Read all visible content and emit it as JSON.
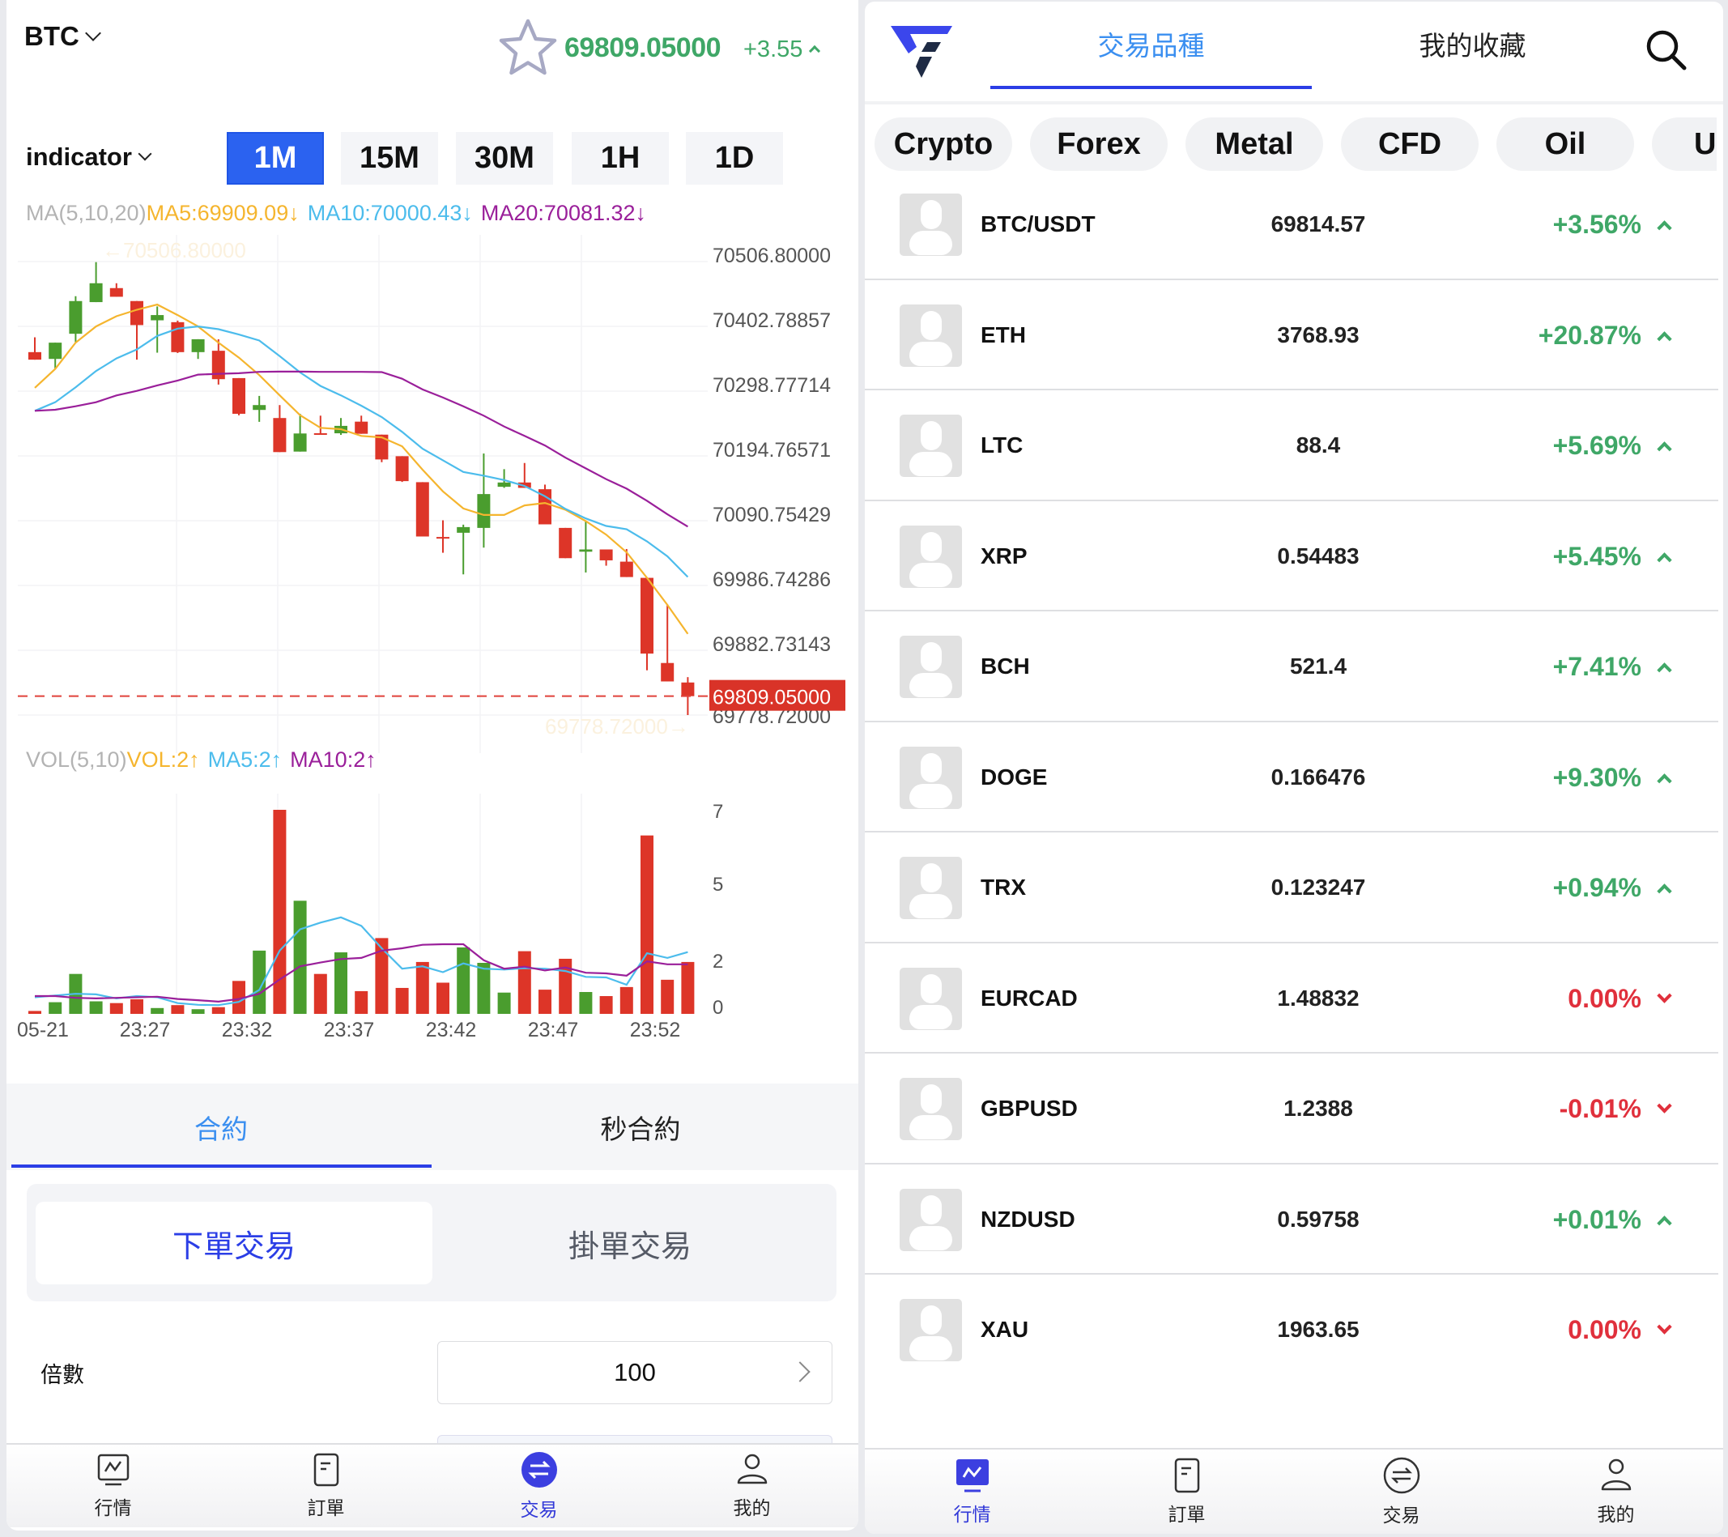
{
  "left": {
    "symbol": "BTC",
    "price": "69809.05000",
    "change": "+3.55",
    "indicator_label": "indicator",
    "timeframes": [
      {
        "label": "1M",
        "active": true
      },
      {
        "label": "15M",
        "active": false
      },
      {
        "label": "30M",
        "active": false
      },
      {
        "label": "1H",
        "active": false
      },
      {
        "label": "1D",
        "active": false
      }
    ],
    "ma_legend": {
      "name": "MA(5,10,20)",
      "ma5": "MA5:69909.09↓",
      "ma10": "MA10:70000.43↓",
      "ma20": "MA20:70081.32↓"
    },
    "vol_legend": {
      "name": "VOL(5,10)",
      "vol": "VOL:2↑",
      "ma5": "MA5:2↑",
      "ma10": "MA10:2↑"
    },
    "contract_tabs": [
      {
        "label": "合約",
        "active": true
      },
      {
        "label": "秒合約",
        "active": false
      }
    ],
    "order_types": [
      {
        "label": "下單交易",
        "active": true
      },
      {
        "label": "掛單交易",
        "active": false
      }
    ],
    "leverage_label": "倍數",
    "leverage_value": "100",
    "bottom_nav": [
      {
        "label": "行情",
        "icon": "market-chart-icon",
        "active": false
      },
      {
        "label": "訂單",
        "icon": "order-doc-icon",
        "active": false
      },
      {
        "label": "交易",
        "icon": "trade-exchange-icon",
        "active": true
      },
      {
        "label": "我的",
        "icon": "user-profile-icon",
        "active": false
      }
    ]
  },
  "right": {
    "tabs": [
      {
        "label": "交易品種",
        "active": true
      },
      {
        "label": "我的收藏",
        "active": false
      }
    ],
    "categories": [
      "Crypto",
      "Forex",
      "Metal",
      "CFD",
      "Oil",
      "U"
    ],
    "markets": [
      {
        "name": "BTC/USDT",
        "price": "69814.57",
        "change": "+3.56%",
        "direction": "up"
      },
      {
        "name": "ETH",
        "price": "3768.93",
        "change": "+20.87%",
        "direction": "up"
      },
      {
        "name": "LTC",
        "price": "88.4",
        "change": "+5.69%",
        "direction": "up"
      },
      {
        "name": "XRP",
        "price": "0.54483",
        "change": "+5.45%",
        "direction": "up"
      },
      {
        "name": "BCH",
        "price": "521.4",
        "change": "+7.41%",
        "direction": "up"
      },
      {
        "name": "DOGE",
        "price": "0.166476",
        "change": "+9.30%",
        "direction": "up"
      },
      {
        "name": "TRX",
        "price": "0.123247",
        "change": "+0.94%",
        "direction": "up"
      },
      {
        "name": "EURCAD",
        "price": "1.48832",
        "change": "0.00%",
        "direction": "down"
      },
      {
        "name": "GBPUSD",
        "price": "1.2388",
        "change": "-0.01%",
        "direction": "down"
      },
      {
        "name": "NZDUSD",
        "price": "0.59758",
        "change": "+0.01%",
        "direction": "up"
      },
      {
        "name": "XAU",
        "price": "1963.65",
        "change": "0.00%",
        "direction": "down"
      }
    ],
    "bottom_nav": [
      {
        "label": "行情",
        "icon": "market-chart-icon",
        "active": true
      },
      {
        "label": "訂單",
        "icon": "order-doc-icon",
        "active": false
      },
      {
        "label": "交易",
        "icon": "trade-exchange-icon",
        "active": false
      },
      {
        "label": "我的",
        "icon": "user-profile-icon",
        "active": false
      }
    ]
  },
  "colors": {
    "up": "#3fa767",
    "down": "#e0303c",
    "candle_up": "#4a9d2e",
    "candle_down": "#dd3528",
    "ma5": "#f5b52e",
    "ma10": "#4cbcec",
    "ma20": "#9a1f9a",
    "accent": "#2b3ee6",
    "tab_active_text": "#3b8ff0"
  },
  "chart_data": [
    {
      "type": "candlestick",
      "title": "BTC 1M",
      "price_axis_ticks": [
        "70506.80000",
        "70402.78857",
        "70298.77714",
        "70194.76571",
        "70090.75429",
        "69986.74286",
        "69882.73143",
        "69778.72000"
      ],
      "ylim": [
        69778.72,
        70506.8
      ],
      "max_marker": "←70506.80000",
      "min_marker": "69778.72000→",
      "last_price": 69809.05,
      "last_price_label": "69809.05000",
      "candles": [
        {
          "o": 70361.4,
          "h": 70385.2,
          "l": 70349.3,
          "c": 70349.3
        },
        {
          "o": 70350.5,
          "h": 70376.6,
          "l": 70335.3,
          "c": 70376.6
        },
        {
          "o": 70390.9,
          "h": 70451.2,
          "l": 70376.6,
          "c": 70443.4
        },
        {
          "o": 70441.7,
          "h": 70505.9,
          "l": 70441.7,
          "c": 70472.0
        },
        {
          "o": 70464.2,
          "h": 70472.0,
          "l": 70450.3,
          "c": 70450.3
        },
        {
          "o": 70443.4,
          "h": 70443.4,
          "l": 70349.3,
          "c": 70404.8
        },
        {
          "o": 70412.5,
          "h": 70434.7,
          "l": 70360.5,
          "c": 70420.9
        },
        {
          "o": 70409.5,
          "h": 70412.0,
          "l": 70360.0,
          "c": 70361.4
        },
        {
          "o": 70361.4,
          "h": 70382.1,
          "l": 70350.5,
          "c": 70382.1
        },
        {
          "o": 70363.6,
          "h": 70382.1,
          "l": 70309.3,
          "c": 70318.0
        },
        {
          "o": 70319.7,
          "h": 70319.7,
          "l": 70260.0,
          "c": 70262.4
        },
        {
          "o": 70268.6,
          "h": 70291.1,
          "l": 70249.5,
          "c": 70276.4
        },
        {
          "o": 70255.6,
          "h": 70276.4,
          "l": 70200.9,
          "c": 70200.9
        },
        {
          "o": 70201.7,
          "h": 70262.4,
          "l": 70201.7,
          "c": 70230.8
        },
        {
          "o": 70231.2,
          "h": 70259.4,
          "l": 70230.8,
          "c": 70230.8
        },
        {
          "o": 70231.1,
          "h": 70255.6,
          "l": 70228.5,
          "c": 70243.0
        },
        {
          "o": 70249.8,
          "h": 70259.4,
          "l": 70230.3,
          "c": 70230.3
        },
        {
          "o": 70228.9,
          "h": 70228.9,
          "l": 70184.7,
          "c": 70189.1
        },
        {
          "o": 70194.3,
          "h": 70194.3,
          "l": 70153.0,
          "c": 70154.3
        },
        {
          "o": 70152.6,
          "h": 70152.6,
          "l": 70065.4,
          "c": 70065.4
        },
        {
          "o": 70064.6,
          "h": 70091.4,
          "l": 70039.3,
          "c": 70064.1
        },
        {
          "o": 70071.4,
          "h": 70084.4,
          "l": 70004.6,
          "c": 70080.5
        },
        {
          "o": 70079.2,
          "h": 70198.6,
          "l": 70047.6,
          "c": 70133.5
        },
        {
          "o": 70145.2,
          "h": 70173.5,
          "l": 70143.5,
          "c": 70152.1
        },
        {
          "o": 70152.1,
          "h": 70183.4,
          "l": 70143.5,
          "c": 70143.5
        },
        {
          "o": 70141.3,
          "h": 70148.7,
          "l": 70084.9,
          "c": 70084.9
        },
        {
          "o": 70079.2,
          "h": 70079.2,
          "l": 70030.6,
          "c": 70030.6
        },
        {
          "o": 70041.0,
          "h": 70090.1,
          "l": 70007.6,
          "c": 70044.6
        },
        {
          "o": 70044.6,
          "h": 70044.6,
          "l": 70018.5,
          "c": 70027.1
        },
        {
          "o": 70025.0,
          "h": 70045.3,
          "l": 70000.3,
          "c": 70000.3
        },
        {
          "o": 69999.0,
          "h": 69999.0,
          "l": 69850.6,
          "c": 69877.4
        },
        {
          "o": 69862.3,
          "h": 69956.4,
          "l": 69832.7,
          "c": 69832.7
        },
        {
          "o": 69831.0,
          "h": 69839.6,
          "l": 69778.7,
          "c": 69809.05
        }
      ],
      "series": [
        {
          "name": "MA5",
          "values": [
            70304.1,
            70334.4,
            70376.6,
            70402.6,
            70419.0,
            70429.5,
            70437.8,
            70420.9,
            70402.6,
            70376.6,
            70352.6,
            70324.5,
            70292.0,
            70260.2,
            70239.9,
            70237.7,
            70226.9,
            70224.6,
            70210.3,
            70172.6,
            70137.8,
            70110.4,
            70100.0,
            70100.0,
            70115.3,
            70119.2,
            70108.4,
            70090.1,
            70068.4,
            70040.1,
            69999.0,
            69955.5,
            69909.09
          ]
        },
        {
          "name": "MA10",
          "values": [
            70267.2,
            70281.0,
            70305.0,
            70331.0,
            70351.3,
            70365.7,
            70387.4,
            70399.1,
            70402.6,
            70398.2,
            70389.6,
            70380.0,
            70354.9,
            70328.8,
            70307.1,
            70292.0,
            70275.4,
            70257.2,
            70233.4,
            70206.4,
            70187.8,
            70169.0,
            70163.0,
            70156.0,
            70146.5,
            70130.0,
            70109.7,
            70094.4,
            70082.3,
            70077.1,
            70057.6,
            70033.6,
            70000.43
          ]
        },
        {
          "name": "MA20",
          "values": [
            70267.2,
            70268.9,
            70274.5,
            70281.0,
            70291.9,
            70299.2,
            70308.0,
            70315.8,
            70325.3,
            70326.6,
            70327.5,
            70329.7,
            70330.1,
            70330.1,
            70329.7,
            70329.7,
            70329.7,
            70329.3,
            70318.7,
            70301.5,
            70288.5,
            70274.5,
            70259.4,
            70242.0,
            70226.9,
            70211.6,
            70192.1,
            70174.8,
            70157.4,
            70142.3,
            70122.7,
            70101.0,
            70081.32
          ]
        }
      ]
    },
    {
      "type": "bar",
      "title": "VOL(5,10)",
      "ylim": [
        0,
        7
      ],
      "y_ticks": [
        "7",
        "5",
        "2",
        "0"
      ],
      "x_tick_labels": [
        "05-21",
        "23:27",
        "23:32",
        "23:37",
        "23:42",
        "23:47",
        "23:52"
      ],
      "x_tick_indices": [
        1,
        6,
        11,
        16,
        21,
        26,
        31
      ],
      "values": [
        0.1,
        0.4,
        1.37,
        0.43,
        0.37,
        0.5,
        0.2,
        0.3,
        0.16,
        0.23,
        1.13,
        2.17,
        7.0,
        3.88,
        1.37,
        2.11,
        0.78,
        2.6,
        0.89,
        1.78,
        1.07,
        2.28,
        1.75,
        0.73,
        2.15,
        0.83,
        1.89,
        0.75,
        0.61,
        0.92,
        6.12,
        1.17,
        1.78
      ],
      "series": [
        {
          "name": "MA5",
          "values": [
            0.57,
            0.63,
            0.69,
            0.67,
            0.53,
            0.61,
            0.57,
            0.37,
            0.31,
            0.3,
            0.41,
            0.82,
            2.17,
            2.9,
            3.13,
            3.31,
            3.02,
            2.25,
            1.55,
            1.63,
            1.43,
            1.73,
            1.55,
            1.52,
            1.57,
            1.55,
            1.47,
            1.27,
            1.25,
            1.0,
            2.08,
            1.92,
            2.12
          ]
        },
        {
          "name": "MA10",
          "values": [
            0.61,
            0.61,
            0.55,
            0.53,
            0.55,
            0.57,
            0.59,
            0.51,
            0.47,
            0.42,
            0.51,
            0.69,
            1.18,
            1.63,
            1.76,
            1.88,
            1.92,
            2.17,
            2.25,
            2.37,
            2.39,
            2.39,
            1.84,
            1.55,
            1.62,
            1.49,
            1.59,
            1.41,
            1.39,
            1.31,
            1.8,
            1.7,
            1.7
          ]
        }
      ]
    }
  ]
}
